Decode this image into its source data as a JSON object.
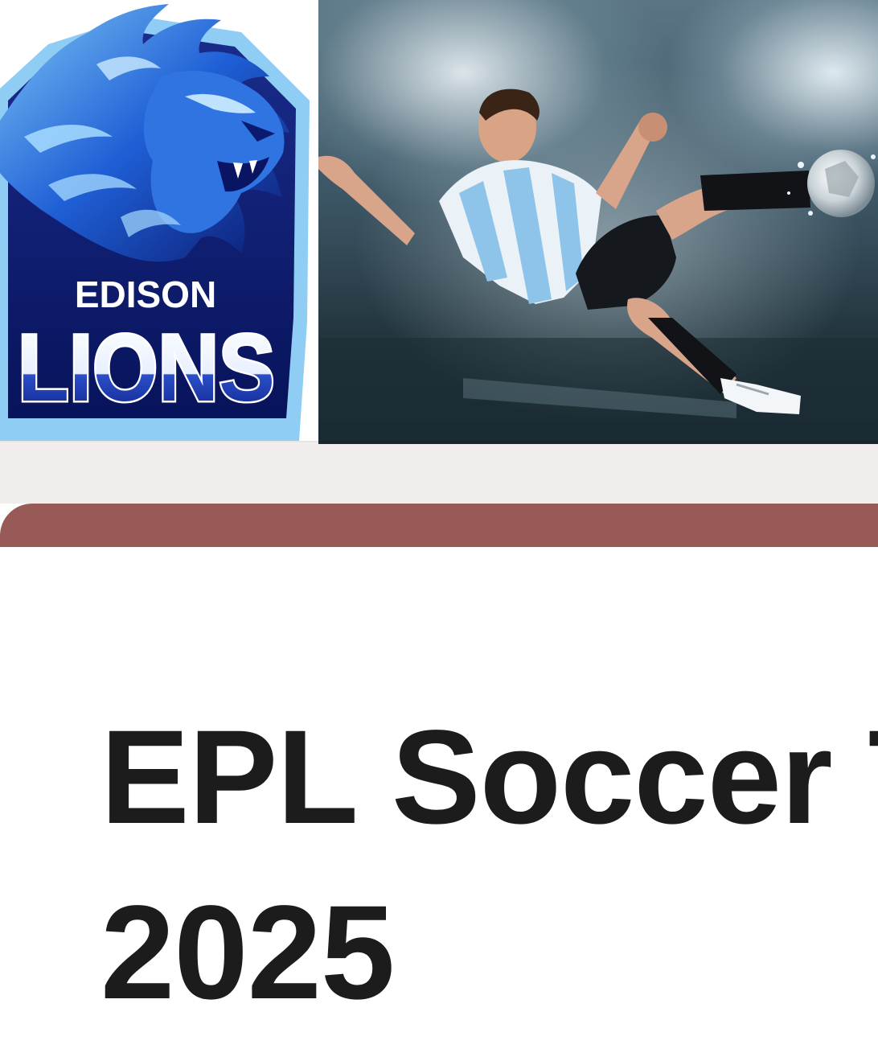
{
  "header": {
    "logo": {
      "icon": "edison-lions-logo",
      "line1": "EDISON",
      "line2": "LIONS",
      "colors": {
        "dark_blue": "#0a1a6e",
        "mid_blue": "#1f5fd6",
        "light_blue": "#79bff0"
      }
    },
    "hero_image": {
      "icon": "soccer-player-photo"
    }
  },
  "nav_bar": {
    "color": "#975a57"
  },
  "page": {
    "background_strip": "#f2eded",
    "title_line1": "EPL Soccer T",
    "title_line2": "2025"
  }
}
